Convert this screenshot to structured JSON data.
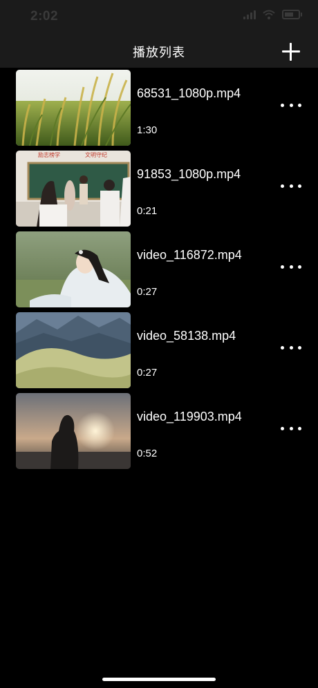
{
  "status_bar": {
    "time": "2:02"
  },
  "nav": {
    "title": "播放列表",
    "add_icon": "plus-icon"
  },
  "playlist": [
    {
      "name": "68531_1080p.mp4",
      "duration": "1:30",
      "thumb": "rice-field"
    },
    {
      "name": "91853_1080p.mp4",
      "duration": "0:21",
      "thumb": "classroom"
    },
    {
      "name": "video_116872.mp4",
      "duration": "0:27",
      "thumb": "woman-in-tea-field"
    },
    {
      "name": "video_58138.mp4",
      "duration": "0:27",
      "thumb": "mountain-dunes"
    },
    {
      "name": "video_119903.mp4",
      "duration": "0:52",
      "thumb": "sunset-silhouette"
    }
  ],
  "classroom_sign": {
    "left": "励志榜学",
    "right": "文明守纪"
  }
}
